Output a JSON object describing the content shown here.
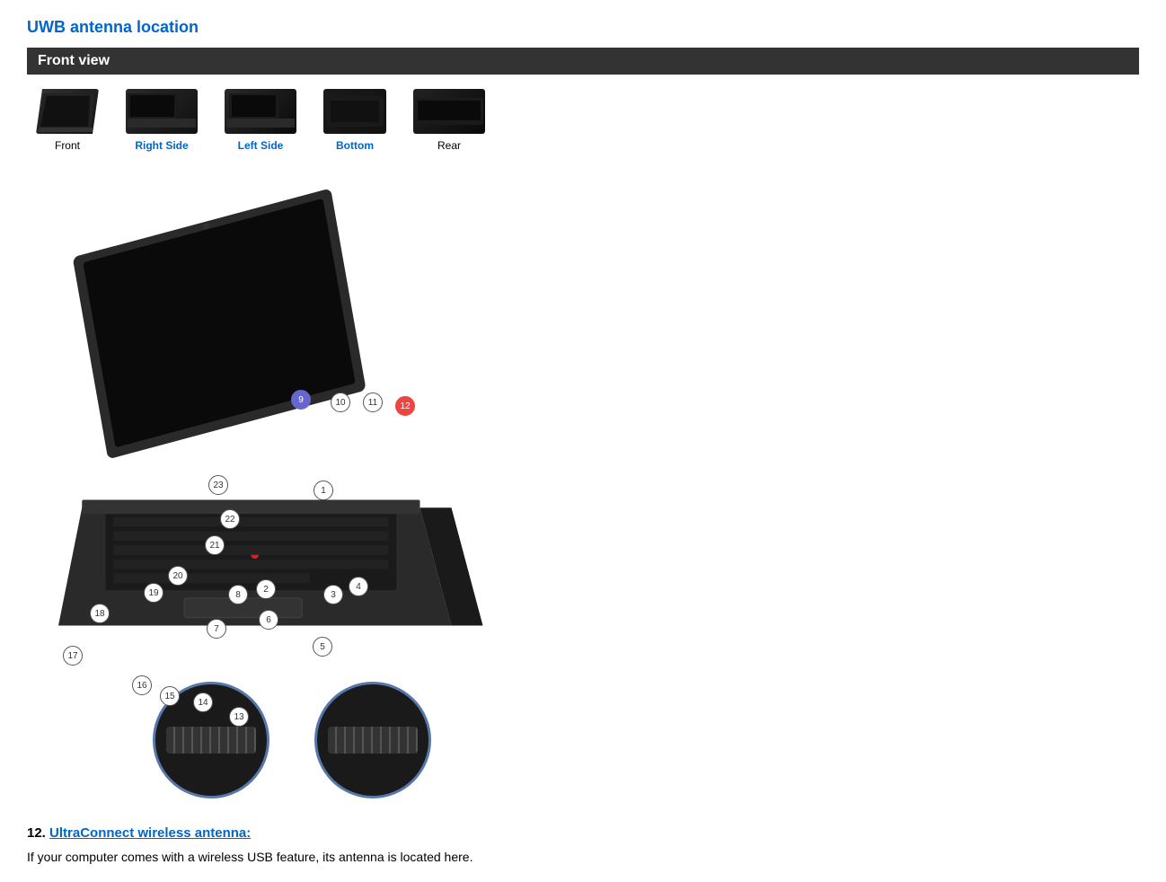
{
  "page": {
    "title": "UWB antenna location",
    "section_header": "Front view"
  },
  "nav": {
    "items": [
      {
        "id": "front",
        "label": "Front",
        "active": true
      },
      {
        "id": "right-side",
        "label": "Right Side",
        "active": false
      },
      {
        "id": "left-side",
        "label": "Left Side",
        "active": false
      },
      {
        "id": "bottom",
        "label": "Bottom",
        "active": false
      },
      {
        "id": "rear",
        "label": "Rear",
        "active": false
      }
    ]
  },
  "diagram": {
    "badges": [
      1,
      2,
      3,
      4,
      5,
      6,
      7,
      8,
      9,
      10,
      11,
      12,
      13,
      14,
      15,
      16,
      17,
      18,
      19,
      20,
      21,
      22,
      23
    ],
    "highlighted_badge": 12,
    "purple_badge": 9
  },
  "description": {
    "item_number": "12.",
    "item_link_text": "UltraConnect wireless antenna:",
    "item_description": "If your computer comes with a wireless USB feature, its antenna is located here."
  }
}
